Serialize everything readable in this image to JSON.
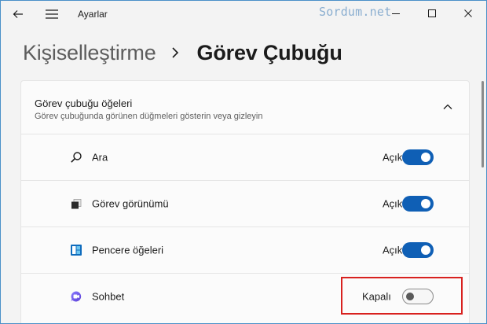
{
  "window": {
    "title": "Ayarlar",
    "watermark": "Sordum.net"
  },
  "breadcrumb": {
    "parent": "Kişiselleştirme",
    "current": "Görev Çubuğu"
  },
  "section": {
    "title": "Görev çubuğu öğeleri",
    "subtitle": "Görev çubuğunda görünen düğmeleri gösterin veya gizleyin",
    "expanded": true
  },
  "items": [
    {
      "label": "Ara",
      "icon": "search-icon",
      "state_label": "Açık",
      "on": true
    },
    {
      "label": "Görev görünümü",
      "icon": "task-view-icon",
      "state_label": "Açık",
      "on": true
    },
    {
      "label": "Pencere öğeleri",
      "icon": "widgets-icon",
      "state_label": "Açık",
      "on": true
    },
    {
      "label": "Sohbet",
      "icon": "chat-icon",
      "state_label": "Kapalı",
      "on": false
    }
  ],
  "colors": {
    "accent": "#0f5fb5",
    "highlight": "#d8211f",
    "watermark": "#8aaed0"
  }
}
